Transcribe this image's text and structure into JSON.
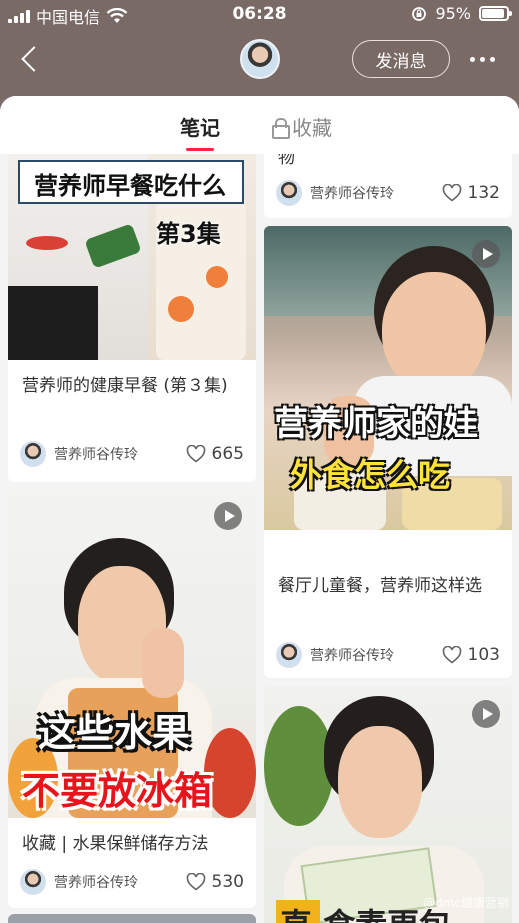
{
  "status": {
    "carrier": "中国电信",
    "time": "06:28",
    "battery": "95%",
    "battery_level": 0.95
  },
  "nav": {
    "message_button": "发消息"
  },
  "tabs": {
    "notes": "笔记",
    "favorites": "收藏"
  },
  "cards": {
    "c1": {
      "overlay_title": "营养师早餐吃什么",
      "overlay_episode": "第3集",
      "caption": "营养师的健康早餐 (第３集)",
      "author": "营养师谷传玲",
      "likes": "665"
    },
    "c2": {
      "caption_tail": "物",
      "author": "营养师谷传玲",
      "likes": "132"
    },
    "c3": {
      "overlay_line1": "营养师家的娃",
      "overlay_line2": "外食怎么吃",
      "caption": "餐厅儿童餐，营养师这样选",
      "author": "营养师谷传玲",
      "likes": "103"
    },
    "c4": {
      "overlay_line1": "这些水果",
      "overlay_line2": "不要放冰箱",
      "caption": "收藏 | 水果保鲜储存方法",
      "author": "营养师谷传玲",
      "likes": "530"
    },
    "c5": {
      "overlay_partial": "直 食素更包"
    }
  },
  "watermark": "@dmc健康营销",
  "icons": {
    "back": "chevron-left-icon",
    "more": "more-dots-icon",
    "lock": "lock-icon",
    "heart": "heart-icon",
    "play": "play-icon",
    "wifi": "wifi-icon"
  }
}
